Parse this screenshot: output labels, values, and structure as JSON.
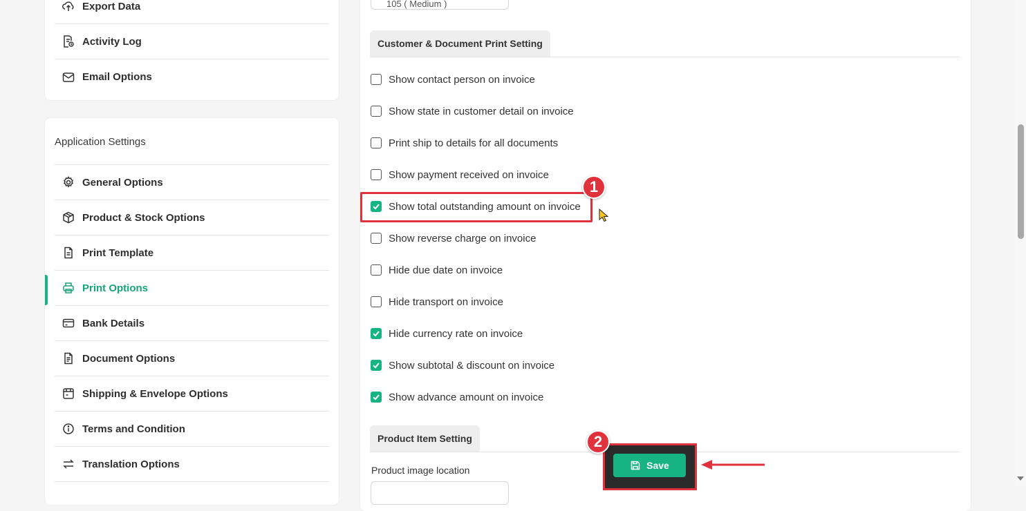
{
  "sidebar": {
    "account_items": [
      {
        "label": "Export Data",
        "icon": "cloud-upload-icon"
      },
      {
        "label": "Activity Log",
        "icon": "activity-log-icon"
      },
      {
        "label": "Email Options",
        "icon": "envelope-icon"
      }
    ],
    "app_settings": {
      "heading": "Application Settings",
      "items": [
        {
          "label": "General Options",
          "icon": "gear-icon"
        },
        {
          "label": "Product & Stock Options",
          "icon": "box-icon"
        },
        {
          "label": "Print Template",
          "icon": "document-icon"
        },
        {
          "label": "Print Options",
          "icon": "printer-icon",
          "active": true
        },
        {
          "label": "Bank Details",
          "icon": "credit-card-icon"
        },
        {
          "label": "Document Options",
          "icon": "document-lines-icon"
        },
        {
          "label": "Shipping & Envelope Options",
          "icon": "shipping-icon"
        },
        {
          "label": "Terms and Condition",
          "icon": "info-icon"
        },
        {
          "label": "Translation Options",
          "icon": "swap-arrows-icon"
        }
      ]
    }
  },
  "main": {
    "top_select_value": "105 ( Medium )",
    "customer_section": {
      "title": "Customer & Document Print Setting",
      "options": [
        {
          "label": "Show contact person on invoice",
          "checked": false
        },
        {
          "label": "Show state in customer detail on invoice",
          "checked": false
        },
        {
          "label": "Print ship to details for all documents",
          "checked": false
        },
        {
          "label": "Show payment received on invoice",
          "checked": false
        },
        {
          "label": "Show total outstanding amount on invoice",
          "checked": true
        },
        {
          "label": "Show reverse charge on invoice",
          "checked": false
        },
        {
          "label": "Hide due date on invoice",
          "checked": false
        },
        {
          "label": "Hide transport on invoice",
          "checked": false
        },
        {
          "label": "Hide currency rate on invoice",
          "checked": true
        },
        {
          "label": "Show subtotal & discount on invoice",
          "checked": true
        },
        {
          "label": "Show advance amount on invoice",
          "checked": true
        }
      ]
    },
    "product_section": {
      "title": "Product Item Setting",
      "image_location_label": "Product image location"
    },
    "save_label": "Save"
  },
  "annotations": {
    "step1": "1",
    "step2": "2",
    "highlight_color": "#e0323c"
  },
  "colors": {
    "accent": "#16b383",
    "active_text": "#16a37a"
  }
}
